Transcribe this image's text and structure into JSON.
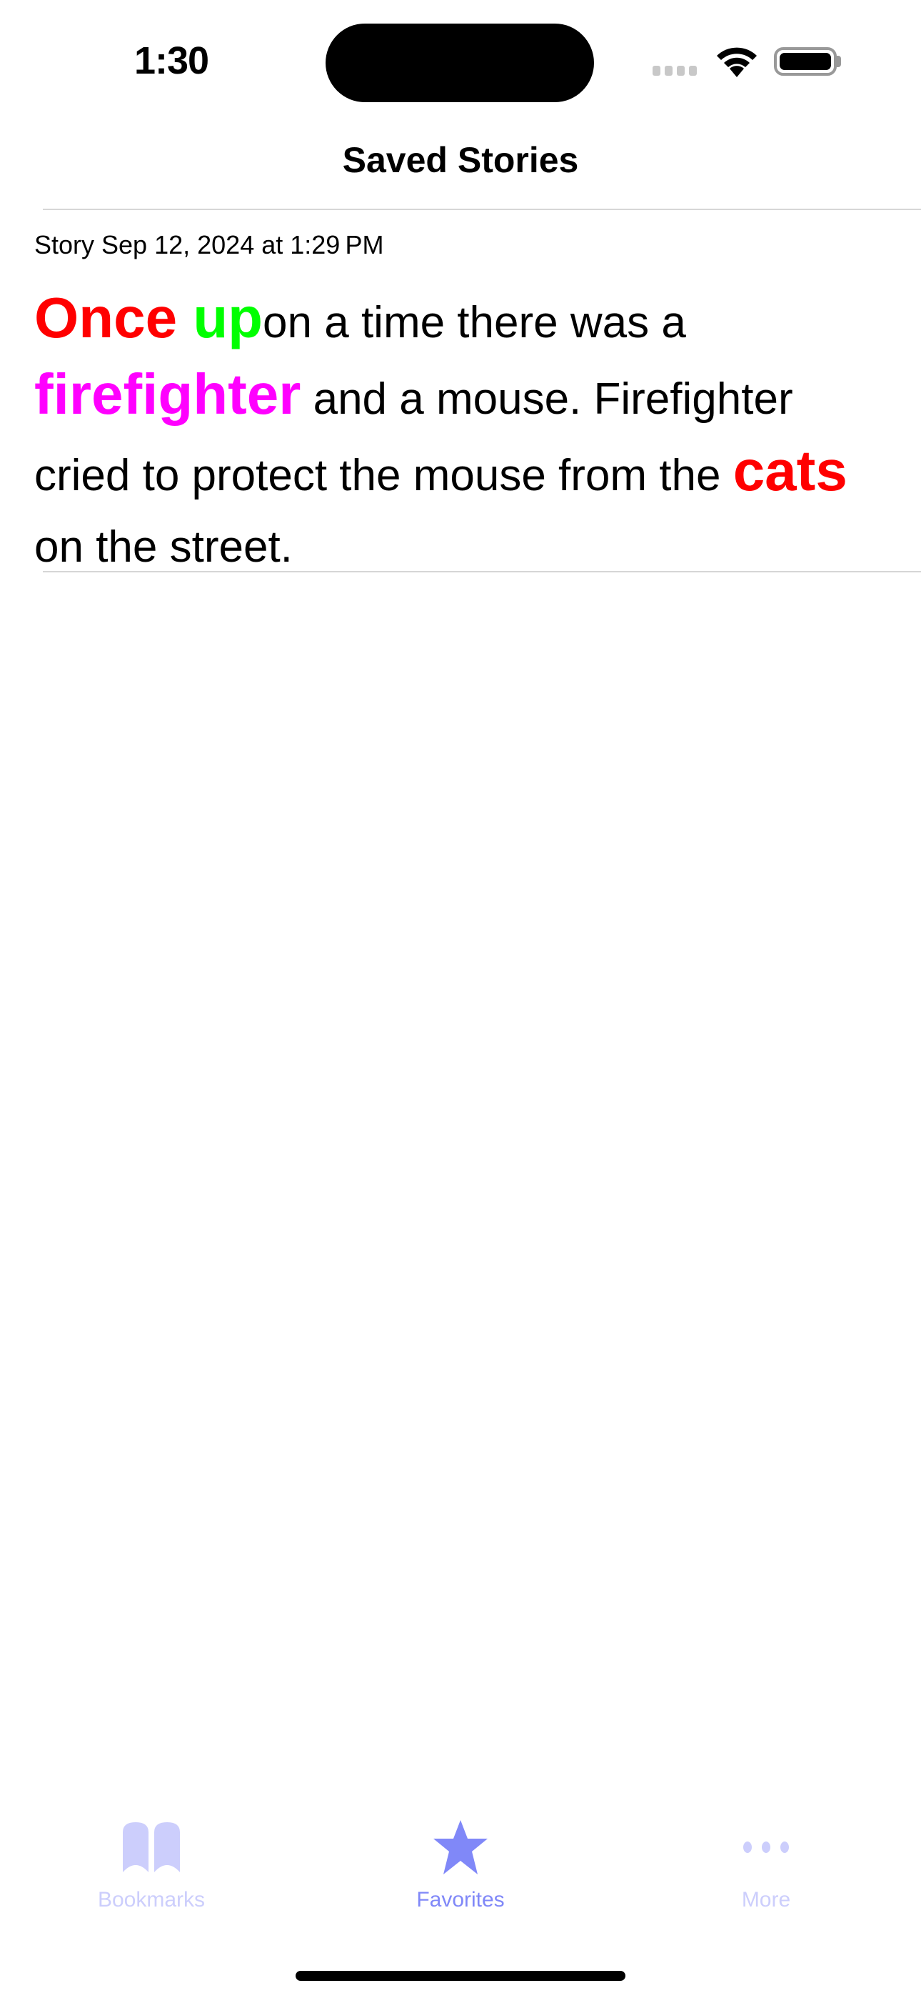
{
  "status_bar": {
    "time": "1:30",
    "signal_icon": "cellular-signal-icon",
    "wifi_icon": "wifi-icon",
    "battery_icon": "battery-icon"
  },
  "nav": {
    "title": "Saved Stories"
  },
  "stories": [
    {
      "meta": "Story Sep 12, 2024 at 1:29 PM",
      "segments": [
        {
          "text": "Once ",
          "style": "big",
          "color": "#ff0000"
        },
        {
          "text": "up",
          "style": "big",
          "color": "#00ff00"
        },
        {
          "text": "on a time there was a ",
          "style": "normal",
          "color": "#000000"
        },
        {
          "text": "firefighter",
          "style": "big",
          "color": "#ff00ff"
        },
        {
          "text": " and a mouse. Firefighter cried to protect the mouse from the ",
          "style": "normal",
          "color": "#000000"
        },
        {
          "text": "cats",
          "style": "big",
          "color": "#ff0000"
        },
        {
          "text": " on the street.",
          "style": "normal",
          "color": "#000000"
        }
      ]
    }
  ],
  "tab_bar": {
    "active_color": "#8088f8",
    "inactive_color": "#cccefc",
    "tabs": [
      {
        "label": "Bookmarks",
        "icon": "book-icon",
        "active": false
      },
      {
        "label": "Favorites",
        "icon": "star-icon",
        "active": true
      },
      {
        "label": "More",
        "icon": "ellipsis-icon",
        "active": false
      }
    ]
  }
}
